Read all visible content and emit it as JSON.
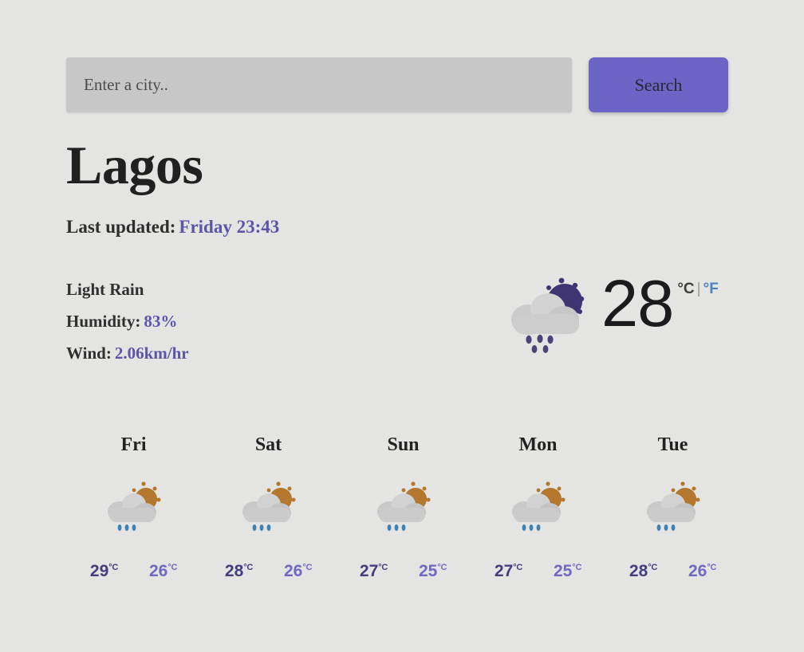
{
  "search": {
    "placeholder": "Enter a city..",
    "value": "",
    "button_label": "Search"
  },
  "current": {
    "city": "Lagos",
    "updated_label": "Last updated:",
    "updated_value": "Friday 23:43",
    "description": "Light Rain",
    "humidity_label": "Humidity:",
    "humidity_value": "83%",
    "wind_label": "Wind:",
    "wind_value": "2.06km/hr",
    "temperature": "28",
    "unit_celsius": "°C",
    "unit_separator": "|",
    "unit_fahrenheit": "°F",
    "icon": "cloud-sun-rain-icon"
  },
  "forecast": [
    {
      "day": "Fri",
      "icon": "cloud-sun-rain-icon",
      "high": "29",
      "low": "26",
      "unit": "°C"
    },
    {
      "day": "Sat",
      "icon": "cloud-sun-rain-icon",
      "high": "28",
      "low": "26",
      "unit": "°C"
    },
    {
      "day": "Sun",
      "icon": "cloud-sun-rain-icon",
      "high": "27",
      "low": "25",
      "unit": "°C"
    },
    {
      "day": "Mon",
      "icon": "cloud-sun-rain-icon",
      "high": "27",
      "low": "25",
      "unit": "°C"
    },
    {
      "day": "Tue",
      "icon": "cloud-sun-rain-icon",
      "high": "28",
      "low": "26",
      "unit": "°C"
    }
  ],
  "colors": {
    "background": "#e7e7e5",
    "input_background": "#c9c9c9",
    "accent_purple": "#6a62c7",
    "text_accent": "#5b52ab",
    "fahrenheit_blue": "#4a7fc1",
    "forecast_high": "#413a7e",
    "forecast_low": "#6f66c4",
    "main_sun": "#3b3170",
    "forecast_sun": "#b5762a",
    "cloud": "#cfcfcf",
    "raindrop_main": "#4a3f7a",
    "raindrop_forecast": "#3d7fb5"
  }
}
